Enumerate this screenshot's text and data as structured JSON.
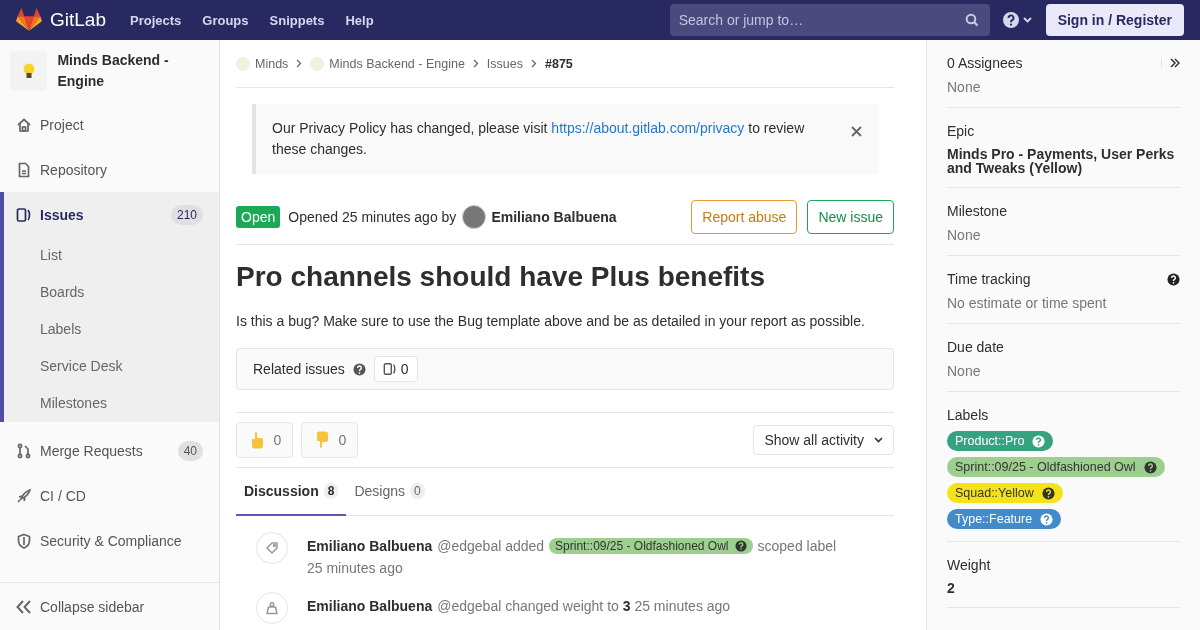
{
  "top_nav": {
    "brand": "GitLab",
    "links": [
      "Projects",
      "Groups",
      "Snippets",
      "Help"
    ],
    "search": {
      "placeholder": "Search or jump to…"
    },
    "sign_in": "Sign in / Register"
  },
  "sidebar": {
    "project_name": "Minds Backend - Engine",
    "items": [
      {
        "label": "Project",
        "selected": false
      },
      {
        "label": "Repository",
        "selected": false
      },
      {
        "label": "Issues",
        "selected": true,
        "count": "210",
        "children": [
          {
            "label": "List"
          },
          {
            "label": "Boards"
          },
          {
            "label": "Labels"
          },
          {
            "label": "Service Desk"
          },
          {
            "label": "Milestones"
          }
        ]
      },
      {
        "label": "Merge Requests",
        "selected": false,
        "count": "40"
      },
      {
        "label": "CI / CD",
        "selected": false
      },
      {
        "label": "Security & Compliance",
        "selected": false
      }
    ],
    "collapse": "Collapse sidebar"
  },
  "breadcrumbs": [
    {
      "label": "Minds",
      "avatar": true,
      "current": false
    },
    {
      "label": "Minds Backend - Engine",
      "avatar": true,
      "current": false
    },
    {
      "label": "Issues",
      "avatar": false,
      "current": false
    },
    {
      "label": "#875",
      "avatar": false,
      "current": true
    }
  ],
  "alert": {
    "text_before": "Our Privacy Policy has changed, please visit",
    "link": "https://about.gitlab.com/privacy",
    "text_after": "to review these changes."
  },
  "issue": {
    "status": "Open",
    "meta": "Opened 25 minutes ago by",
    "author": "Emiliano Balbuena",
    "buttons": [
      {
        "label": "Report abuse",
        "kind": "warning"
      },
      {
        "label": "New issue",
        "kind": "success"
      }
    ],
    "title": "Pro channels should have Plus benefits",
    "description": "Is this a bug? Make sure to use the Bug template above and be as detailed in your report as possible."
  },
  "related": {
    "label": "Related issues",
    "count": "0"
  },
  "awards": [
    {
      "kind": "thumbsup",
      "count": "0"
    },
    {
      "kind": "thumbsdown",
      "count": "0"
    }
  ],
  "activity_filter": "Show all activity",
  "tabs": [
    {
      "label": "Discussion",
      "count": "8",
      "selected": true
    },
    {
      "label": "Designs",
      "count": "0",
      "selected": false
    }
  ],
  "notes": [
    {
      "kind": "label",
      "author": "Emiliano Balbuena",
      "text": "@edgebal added",
      "label": {
        "text": "Sprint::09/25 - Oldfashioned Owl",
        "color": "#9dd08f"
      },
      "suffix": "scoped label",
      "time": "25 minutes ago"
    },
    {
      "kind": "weight",
      "author": "Emiliano Balbuena",
      "text": "@edgebal changed weight to **3** 25 minutes ago"
    }
  ],
  "right_sidebar": [
    {
      "kind": "muted",
      "title": "0 Assignees",
      "value": "None"
    },
    {
      "kind": "strong",
      "title": "Epic",
      "value": "Minds Pro - Payments, User Perks and Tweaks (Yellow)"
    },
    {
      "kind": "muted",
      "title": "Milestone",
      "value": "None"
    },
    {
      "kind": "tracking",
      "title": "Time tracking",
      "value": "No estimate or time spent"
    },
    {
      "kind": "muted",
      "title": "Due date",
      "value": "None"
    },
    {
      "kind": "labels",
      "title": "Labels",
      "labels": [
        {
          "text": "Product::Pro",
          "color": "#36a380"
        },
        {
          "text": "Sprint::09/25 - Oldfashioned Owl",
          "color": "#9dd08f"
        },
        {
          "text": "Squad::Yellow",
          "color": "#f5e31a"
        },
        {
          "text": "Type::Feature",
          "color": "#428bca"
        }
      ]
    },
    {
      "kind": "strong",
      "title": "Weight",
      "value": "2"
    }
  ]
}
